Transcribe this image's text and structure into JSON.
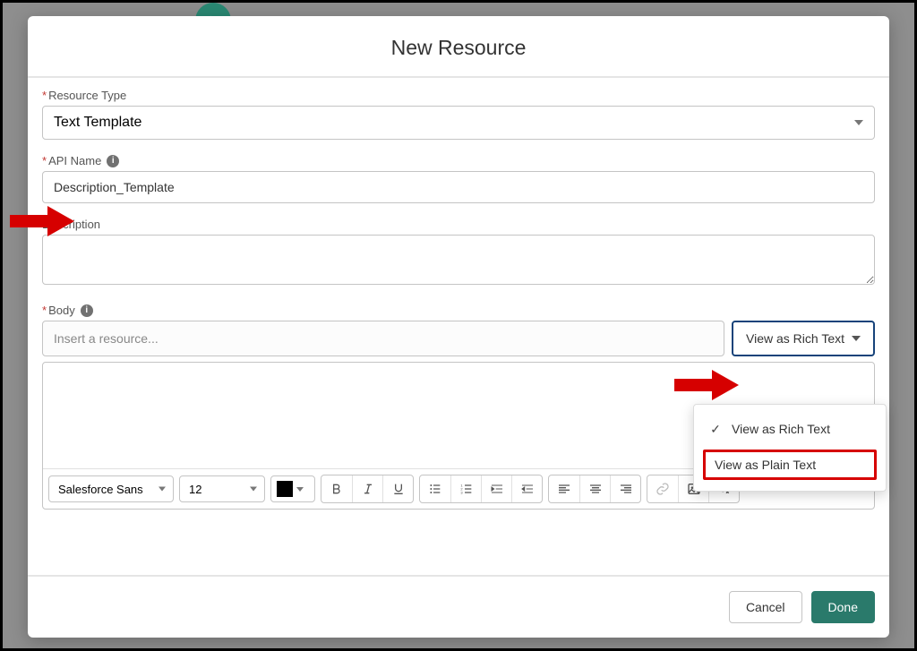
{
  "modal": {
    "title": "New Resource",
    "fields": {
      "resource_type": {
        "label": "Resource Type",
        "value": "Text Template",
        "required": true
      },
      "api_name": {
        "label": "API Name",
        "value": "Description_Template",
        "required": true
      },
      "description": {
        "label": "Description",
        "value": ""
      },
      "body": {
        "label": "Body",
        "required": true,
        "resource_placeholder": "Insert a resource..."
      }
    },
    "view_mode": {
      "button_label": "View as Rich Text",
      "options": {
        "rich": "View as Rich Text",
        "plain": "View as Plain Text"
      },
      "selected": "rich"
    },
    "editor_toolbar": {
      "font": "Salesforce Sans",
      "size": "12",
      "color": "#000000"
    },
    "footer": {
      "cancel": "Cancel",
      "done": "Done"
    }
  }
}
